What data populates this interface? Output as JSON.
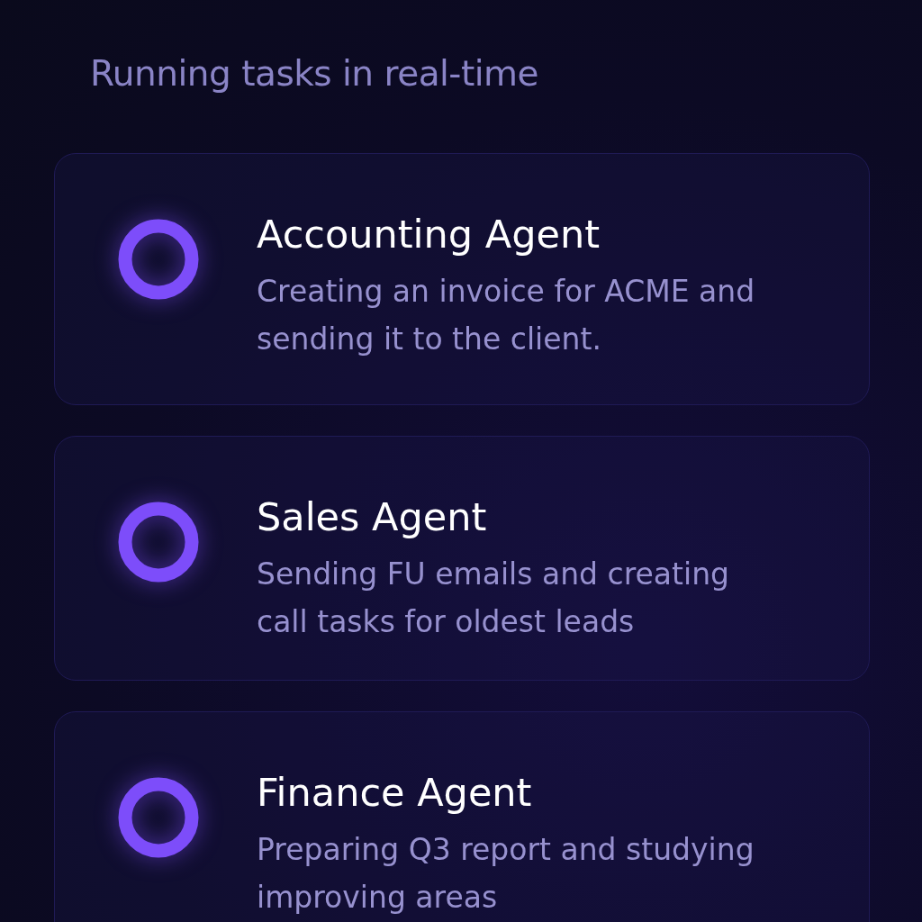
{
  "heading": "Running tasks in real-time",
  "tasks": [
    {
      "name": "Accounting Agent",
      "description": "Creating an invoice for ACME and sending it to the client."
    },
    {
      "name": "Sales Agent",
      "description": "Sending FU emails and creating call tasks for oldest leads"
    },
    {
      "name": "Finance Agent",
      "description": "Preparing Q3 report and studying improving areas"
    }
  ]
}
